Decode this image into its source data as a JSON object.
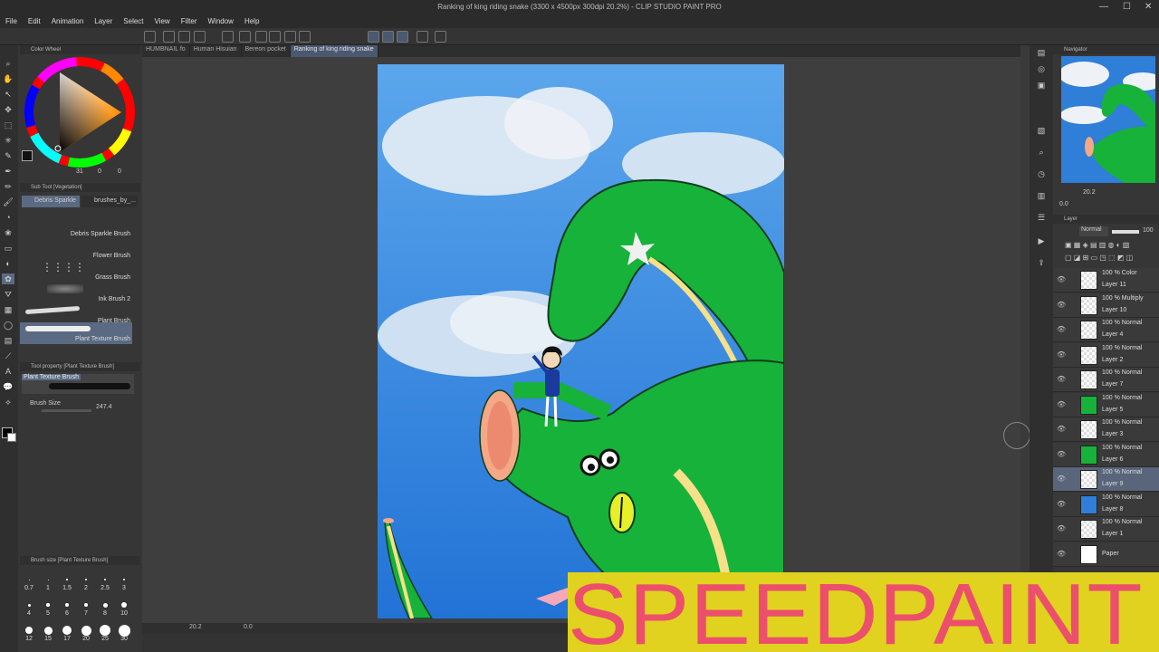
{
  "window": {
    "title": "Ranking of king riding snake (3300 x 4500px 300dpi 20.2%) - CLIP STUDIO PAINT PRO"
  },
  "menu": [
    "File",
    "Edit",
    "Animation",
    "Layer",
    "Select",
    "View",
    "Filter",
    "Window",
    "Help"
  ],
  "tabs": [
    {
      "label": "HUMBNAIL fo",
      "active": false
    },
    {
      "label": "Human Hisuian",
      "active": false
    },
    {
      "label": "Bereon pocket",
      "active": false
    },
    {
      "label": "Ranking of king riding snake",
      "active": true
    }
  ],
  "color_wheel": {
    "title": "Color Wheel",
    "values": [
      "31",
      "0",
      "0"
    ]
  },
  "sub_tool": {
    "title": "Sub Tool [Vegetation]",
    "tabs": [
      "Debris Sparkle",
      "brushes_by_..."
    ],
    "items": [
      {
        "label": "Debris Sparkle Brush",
        "selected": false
      },
      {
        "label": "Flower Brush",
        "selected": false
      },
      {
        "label": "Grass Brush",
        "selected": false
      },
      {
        "label": "Ink Brush 2",
        "selected": false
      },
      {
        "label": "Plant Brush",
        "selected": false
      },
      {
        "label": "Plant Texture Brush",
        "selected": true
      }
    ]
  },
  "tool_property": {
    "title": "Tool property [Plant Texture Brush]",
    "preview_label": "Plant Texture Brush",
    "brush_size_label": "Brush Size",
    "brush_size_value": "247.4"
  },
  "brush_size_panel": {
    "title": "Brush size [Plant Texture Brush]",
    "sizes": [
      "0.7",
      "1",
      "1.5",
      "2",
      "2.5",
      "3",
      "4",
      "5",
      "6",
      "7",
      "8",
      "10",
      "12",
      "15",
      "17",
      "20",
      "25",
      "30"
    ]
  },
  "navigator": {
    "title": "Navigator",
    "zoom": "20.2",
    "angle": "0.0"
  },
  "layer_panel": {
    "title": "Layer",
    "blend_mode": "Normal",
    "opacity": "100",
    "layers": [
      {
        "mode": "100 % Color",
        "name": "Layer 11",
        "selected": false
      },
      {
        "mode": "100 % Multiply",
        "name": "Layer 10",
        "selected": false
      },
      {
        "mode": "100 % Normal",
        "name": "Layer 4",
        "selected": false
      },
      {
        "mode": "100 % Normal",
        "name": "Layer 2",
        "selected": false
      },
      {
        "mode": "100 % Normal",
        "name": "Layer 7",
        "selected": false
      },
      {
        "mode": "100 % Normal",
        "name": "Layer 5",
        "selected": false
      },
      {
        "mode": "100 % Normal",
        "name": "Layer 3",
        "selected": false
      },
      {
        "mode": "100 % Normal",
        "name": "Layer 6",
        "selected": false
      },
      {
        "mode": "100 % Normal",
        "name": "Layer 9",
        "selected": true
      },
      {
        "mode": "100 % Normal",
        "name": "Layer 8",
        "selected": false
      },
      {
        "mode": "100 % Normal",
        "name": "Layer 1",
        "selected": false
      },
      {
        "mode": "",
        "name": "Paper",
        "selected": false
      }
    ]
  },
  "status": {
    "zoom": "20.2",
    "angle": "0.0"
  },
  "overlay": {
    "text": "SPEEDPAINT"
  },
  "colors": {
    "accent": "#5a6a82",
    "overlay_bg": "#e0d21e",
    "overlay_text": "#ec4f6b",
    "sky": "#2f7ed8",
    "snake": "#1fb843"
  }
}
